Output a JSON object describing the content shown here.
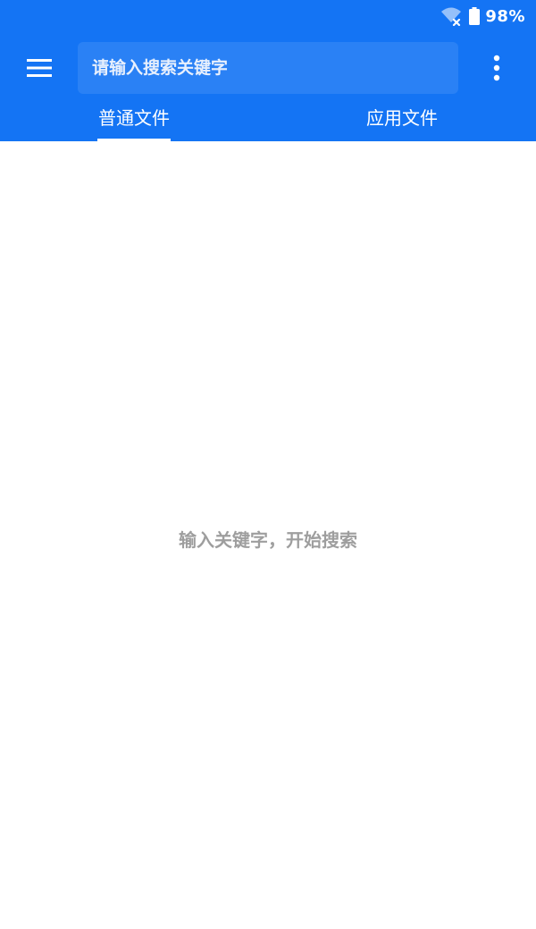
{
  "status_bar": {
    "battery_percent": "98%",
    "wifi_icon": "wifi-off-icon",
    "battery_icon": "battery-icon"
  },
  "toolbar": {
    "menu_icon": "hamburger-menu-icon",
    "more_icon": "more-vertical-icon",
    "search": {
      "placeholder": "请输入搜索关键字",
      "value": ""
    }
  },
  "tabs": [
    {
      "label": "普通文件",
      "selected": true
    },
    {
      "label": "应用文件",
      "selected": false
    }
  ],
  "main": {
    "empty_hint": "输入关键字，开始搜索"
  },
  "colors": {
    "primary": "#1474f4",
    "search_bg": "#2a81f5",
    "hint_text": "#9e9e9e",
    "background": "#ffffff"
  }
}
